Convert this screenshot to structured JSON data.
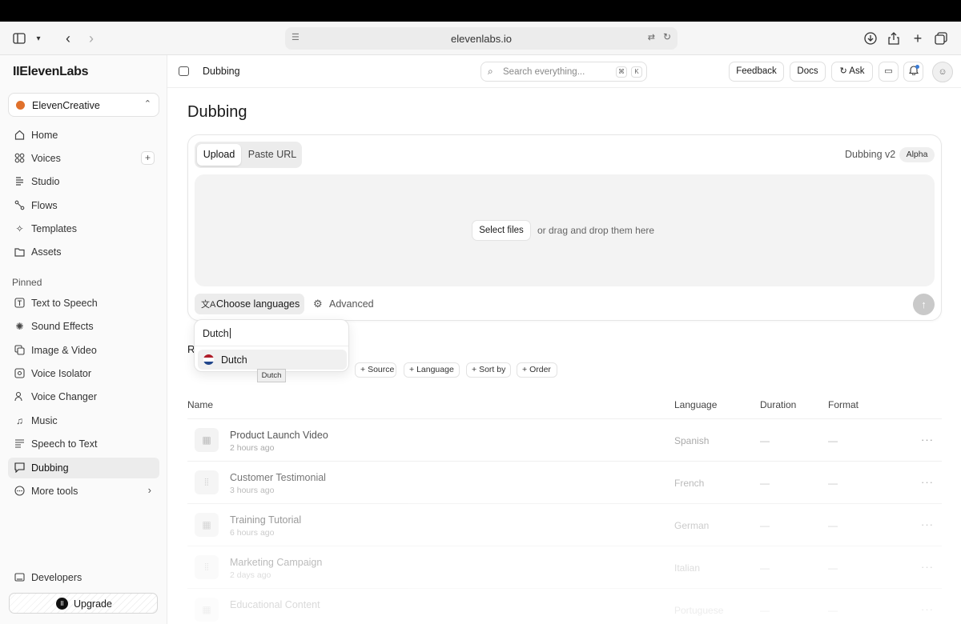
{
  "browser": {
    "url": "elevenlabs.io"
  },
  "sidebar": {
    "logo": "IIElevenLabs",
    "workspace": "ElevenCreative",
    "main_items": [
      {
        "label": "Home",
        "icon": "home-icon"
      },
      {
        "label": "Voices",
        "icon": "voices-icon"
      },
      {
        "label": "Studio",
        "icon": "studio-icon"
      },
      {
        "label": "Flows",
        "icon": "flows-icon"
      },
      {
        "label": "Templates",
        "icon": "templates-icon"
      },
      {
        "label": "Assets",
        "icon": "folder-icon"
      }
    ],
    "pinned_label": "Pinned",
    "pinned_items": [
      {
        "label": "Text to Speech",
        "icon": "text-to-speech-icon"
      },
      {
        "label": "Sound Effects",
        "icon": "sound-effects-icon"
      },
      {
        "label": "Image & Video",
        "icon": "image-video-icon"
      },
      {
        "label": "Voice Isolator",
        "icon": "voice-isolator-icon"
      },
      {
        "label": "Voice Changer",
        "icon": "voice-changer-icon"
      },
      {
        "label": "Music",
        "icon": "music-icon"
      },
      {
        "label": "Speech to Text",
        "icon": "speech-to-text-icon"
      },
      {
        "label": "Dubbing",
        "icon": "dubbing-icon"
      },
      {
        "label": "More tools",
        "icon": "more-tools-icon"
      }
    ],
    "developers": "Developers",
    "upgrade": "Upgrade"
  },
  "header": {
    "title": "Dubbing",
    "search_placeholder": "Search everything...",
    "kbd_cmd": "⌘",
    "kbd_k": "K",
    "feedback": "Feedback",
    "docs": "Docs",
    "ask": "Ask"
  },
  "page": {
    "title": "Dubbing",
    "tabs": [
      "Upload",
      "Paste URL"
    ],
    "version": "Dubbing v2",
    "badge": "Alpha",
    "select_files": "Select files",
    "drop_hint": "or drag and drop them here",
    "choose_languages": "Choose languages",
    "advanced": "Advanced"
  },
  "language_popup": {
    "query": "Dutch",
    "option": "Dutch",
    "tooltip": "Dutch",
    "flag_colors": [
      "#ae1c28",
      "#ffffff",
      "#21468b"
    ]
  },
  "recent": {
    "heading_visible": "R",
    "filters": [
      "Source",
      "Language",
      "Sort by",
      "Order"
    ],
    "columns": [
      "Name",
      "Language",
      "Duration",
      "Format"
    ],
    "rows": [
      {
        "name": "Product Launch Video",
        "time": "2 hours ago",
        "language": "Spanish",
        "duration": "—",
        "format": "—",
        "type": "video-icon"
      },
      {
        "name": "Customer Testimonial",
        "time": "3 hours ago",
        "language": "French",
        "duration": "—",
        "format": "—",
        "type": "audio-icon"
      },
      {
        "name": "Training Tutorial",
        "time": "6 hours ago",
        "language": "German",
        "duration": "—",
        "format": "—",
        "type": "video-icon"
      },
      {
        "name": "Marketing Campaign",
        "time": "2 days ago",
        "language": "Italian",
        "duration": "—",
        "format": "—",
        "type": "audio-icon"
      },
      {
        "name": "Educational Content",
        "time": "",
        "language": "Portuguese",
        "duration": "—",
        "format": "—",
        "type": "video-icon"
      }
    ]
  }
}
